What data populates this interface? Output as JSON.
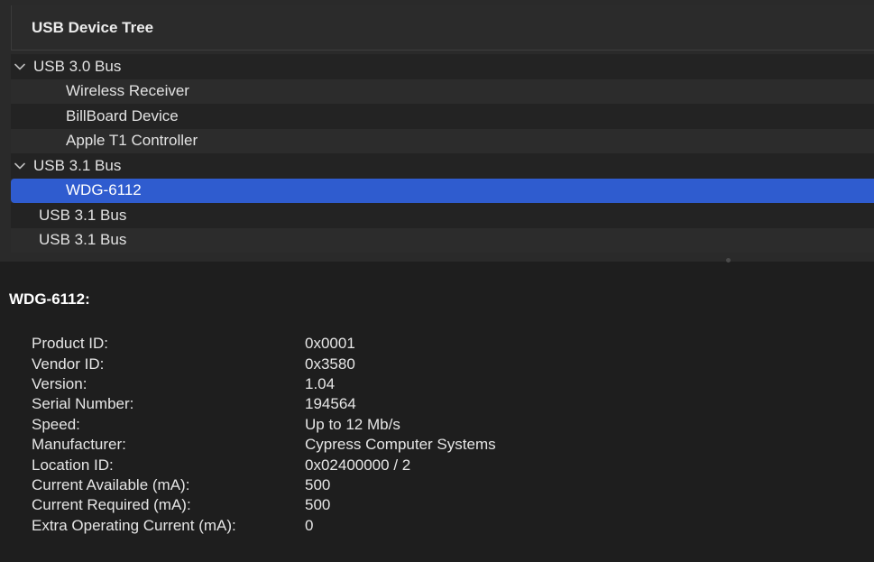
{
  "tree": {
    "header": "USB Device Tree",
    "items": [
      {
        "label": "USB 3.0 Bus",
        "level": 0,
        "expanded": true
      },
      {
        "label": "Wireless Receiver",
        "level": 1
      },
      {
        "label": "BillBoard Device",
        "level": 1
      },
      {
        "label": "Apple T1 Controller",
        "level": 1
      },
      {
        "label": "USB 3.1 Bus",
        "level": 0,
        "expanded": true
      },
      {
        "label": "WDG-6112",
        "level": 1,
        "selected": true
      },
      {
        "label": "USB 3.1 Bus",
        "level": 0
      },
      {
        "label": "USB 3.1 Bus",
        "level": 0
      }
    ]
  },
  "detail": {
    "title": "WDG-6112:",
    "properties": [
      {
        "label": "Product ID:",
        "value": "0x0001"
      },
      {
        "label": "Vendor ID:",
        "value": "0x3580"
      },
      {
        "label": "Version:",
        "value": "1.04"
      },
      {
        "label": "Serial Number:",
        "value": "194564"
      },
      {
        "label": "Speed:",
        "value": "Up to 12 Mb/s"
      },
      {
        "label": "Manufacturer:",
        "value": "Cypress Computer Systems"
      },
      {
        "label": "Location ID:",
        "value": "0x02400000 / 2"
      },
      {
        "label": "Current Available (mA):",
        "value": "500"
      },
      {
        "label": "Current Required (mA):",
        "value": "500"
      },
      {
        "label": "Extra Operating Current (mA):",
        "value": "0"
      }
    ]
  },
  "colors": {
    "selection": "#2f5ccf",
    "background": "#1e1e1e"
  },
  "icons": {
    "expanded": "chevron-down-icon"
  }
}
